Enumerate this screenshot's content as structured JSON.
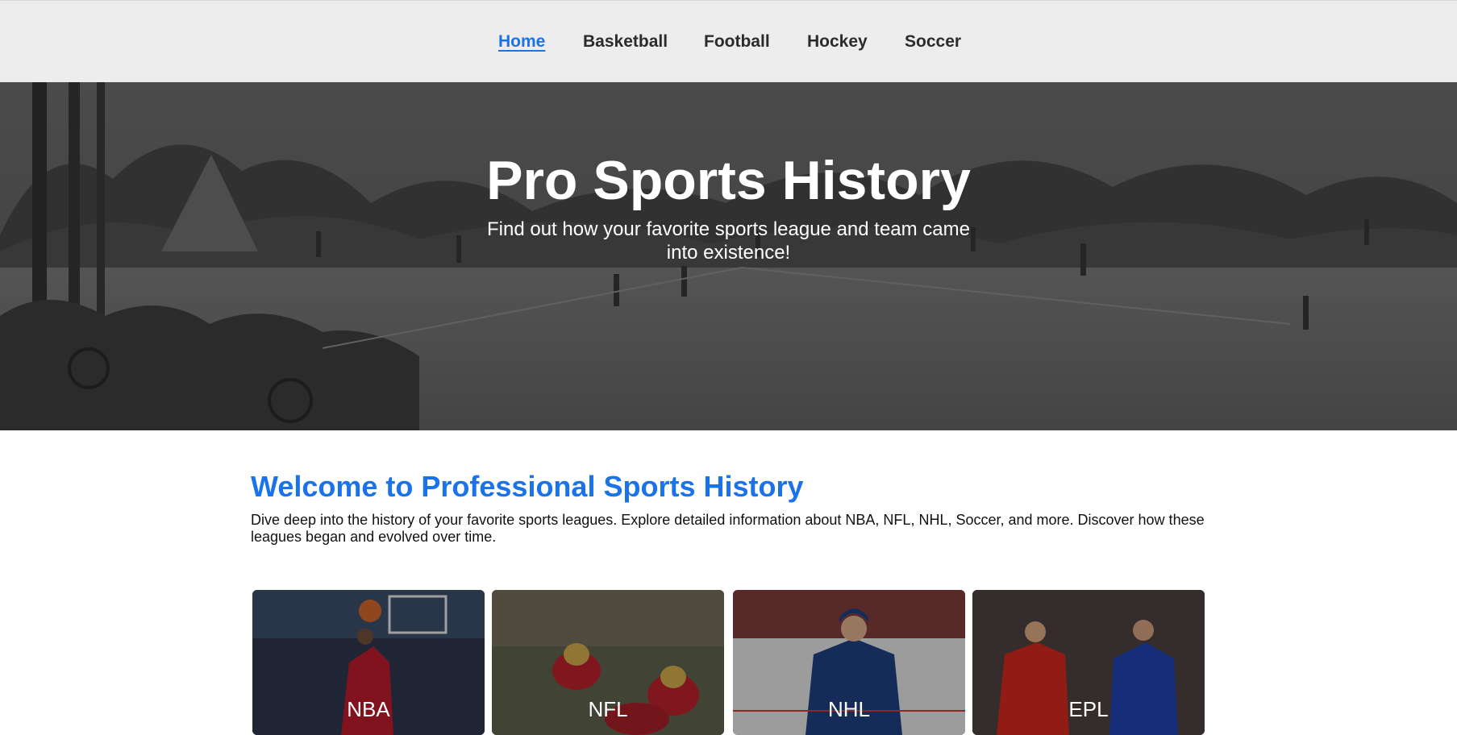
{
  "nav": {
    "items": [
      {
        "label": "Home",
        "active": true
      },
      {
        "label": "Basketball",
        "active": false
      },
      {
        "label": "Football",
        "active": false
      },
      {
        "label": "Hockey",
        "active": false
      },
      {
        "label": "Soccer",
        "active": false
      }
    ]
  },
  "hero": {
    "title": "Pro Sports History",
    "subtitle": "Find out how your favorite sports league and team came into existence!"
  },
  "welcome": {
    "title": "Welcome to Professional Sports History",
    "text": "Dive deep into the history of your favorite sports leagues. Explore detailed information about NBA, NFL, NHL, Soccer, and more. Discover how these leagues began and evolved over time."
  },
  "cards": [
    {
      "label": "NBA"
    },
    {
      "label": "NFL"
    },
    {
      "label": "NHL"
    },
    {
      "label": "EPL"
    }
  ],
  "colors": {
    "accent": "#1a73e8",
    "nav_bg": "#ededed"
  }
}
